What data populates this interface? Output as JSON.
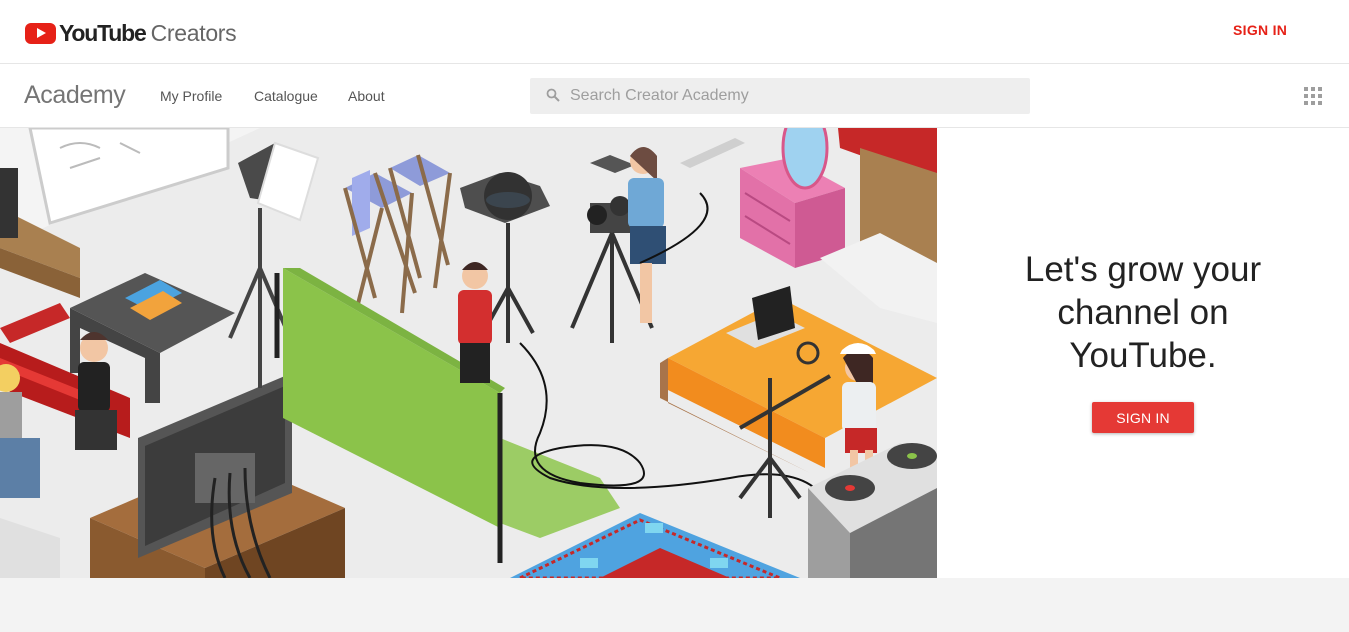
{
  "header": {
    "logo_youtube": "YouTube",
    "logo_creators": "Creators",
    "signin_label": "SIGN IN"
  },
  "nav": {
    "title": "Academy",
    "links": [
      "My Profile",
      "Catalogue",
      "About"
    ],
    "search_placeholder": "Search Creator Academy"
  },
  "hero": {
    "heading": "Let's grow your channel on YouTube.",
    "cta_label": "SIGN IN",
    "illustration": "isometric-creator-studio-illustration"
  },
  "colors": {
    "brand_red": "#e62117",
    "cta_red": "#e53935",
    "search_bg": "#eeeeee",
    "page_bg": "#f3f3f3"
  },
  "icons": [
    "youtube-logo-icon",
    "search-icon",
    "apps-grid-icon"
  ]
}
